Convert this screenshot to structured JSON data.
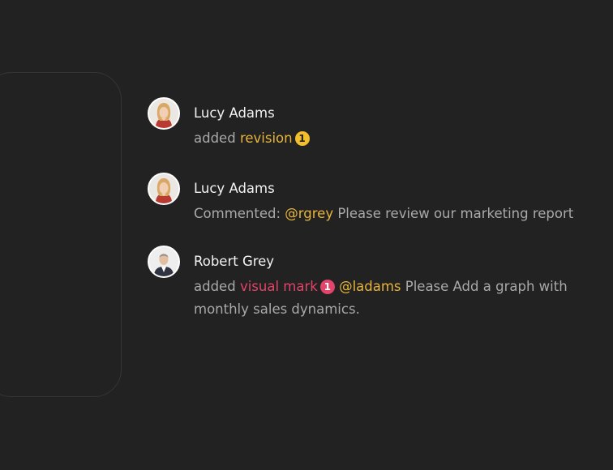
{
  "colors": {
    "background": "#222222",
    "author": "#f2f2f2",
    "text": "#a9a9a9",
    "highlight_yellow": "#e8b53a",
    "highlight_pink": "#e2446a"
  },
  "activity": [
    {
      "author": "Lucy Adams",
      "avatar_icon": "woman-avatar-icon",
      "prefix": "added",
      "link": "revision",
      "badge": "1"
    },
    {
      "author": "Lucy Adams",
      "avatar_icon": "woman-avatar-icon",
      "prefix": "Commented:",
      "mention": "@rgrey",
      "text": "Please review our marketing report"
    },
    {
      "author": "Robert Grey",
      "avatar_icon": "man-avatar-icon",
      "prefix": "added",
      "link": "visual mark",
      "badge": "1",
      "mention": "@ladams",
      "text": "Please Add a graph with monthly sales dynamics."
    }
  ]
}
